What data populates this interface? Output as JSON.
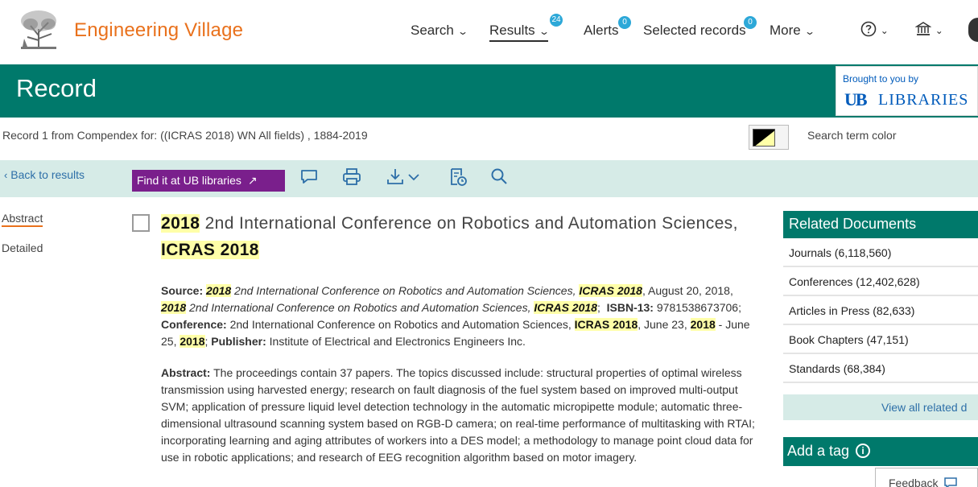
{
  "header": {
    "brand": "Engineering Village",
    "nav": {
      "search": "Search",
      "results": "Results",
      "results_count": "24",
      "alerts": "Alerts",
      "alerts_count": "0",
      "selected": "Selected records",
      "selected_count": "0",
      "more": "More"
    }
  },
  "banner": {
    "title": "Record",
    "brought_by": "Brought to you by",
    "ub_mark": "UB",
    "ub_libraries": "LIBRARIES"
  },
  "record_info": {
    "text": "Record 1 from Compendex for: ((ICRAS 2018) WN All fields) , 1884-2019",
    "search_term_color": "Search term color"
  },
  "toolbar": {
    "back": "Back to results",
    "find_it": "Find it at UB libraries"
  },
  "side": {
    "abstract": "Abstract",
    "detailed": "Detailed"
  },
  "record": {
    "title_hl_1": "2018",
    "title_mid": " 2nd International Conference on Robotics and Automation Sciences, ",
    "title_hl_2": "ICRAS 2018",
    "source_label": "Source:",
    "source_hl_2018": "2018",
    "source_conf_name": " 2nd International Conference on Robotics and Automation Sciences, ",
    "source_hl_icras": "ICRAS 2018",
    "source_date": ", August 20, 2018, ",
    "isbn_label": "ISBN-13:",
    "isbn": "9781538673706;",
    "conference_label": "Conference:",
    "conference_name": "2nd International Conference on Robotics and Automation Sciences, ",
    "conf_hl_icras": "ICRAS 2018",
    "conf_june_23": ", June 23, ",
    "conf_dash": " - June 25, ",
    "publisher_label": "Publisher:",
    "publisher": "Institute of Electrical and Electronics Engineers Inc.",
    "abstract_label": "Abstract:",
    "abstract_text": "The proceedings contain 37 papers. The topics discussed include: structural properties of optimal wireless transmission using harvested energy; research on fault diagnosis of the fuel system based on improved multi-output SVM; application of pressure liquid level detection technology in the automatic micropipette module; automatic three-dimensional ultrasound scanning system based on RGB-D camera; on real-time performance of multitasking with RTAI; incorporating learning and aging attributes of workers into a DES model; a methodology to manage point cloud data for use in robotic applications; and research of EEG recognition algorithm based on motor imagery."
  },
  "related": {
    "heading": "Related Documents",
    "items": [
      "Journals (6,118,560)",
      "Conferences (12,402,628)",
      "Articles in Press (82,633)",
      "Book Chapters (47,151)",
      "Standards (68,384)"
    ],
    "view_all": "View all related d"
  },
  "tag": {
    "heading": "Add a tag"
  },
  "feedback": "Feedback",
  "colors": {
    "brand_orange": "#e9711c",
    "teal": "#00796b",
    "toolbar_bg": "#d6ebe7",
    "find_purple": "#7a1f8c",
    "highlight": "#ffffa8",
    "badge_blue": "#2da8d8"
  }
}
